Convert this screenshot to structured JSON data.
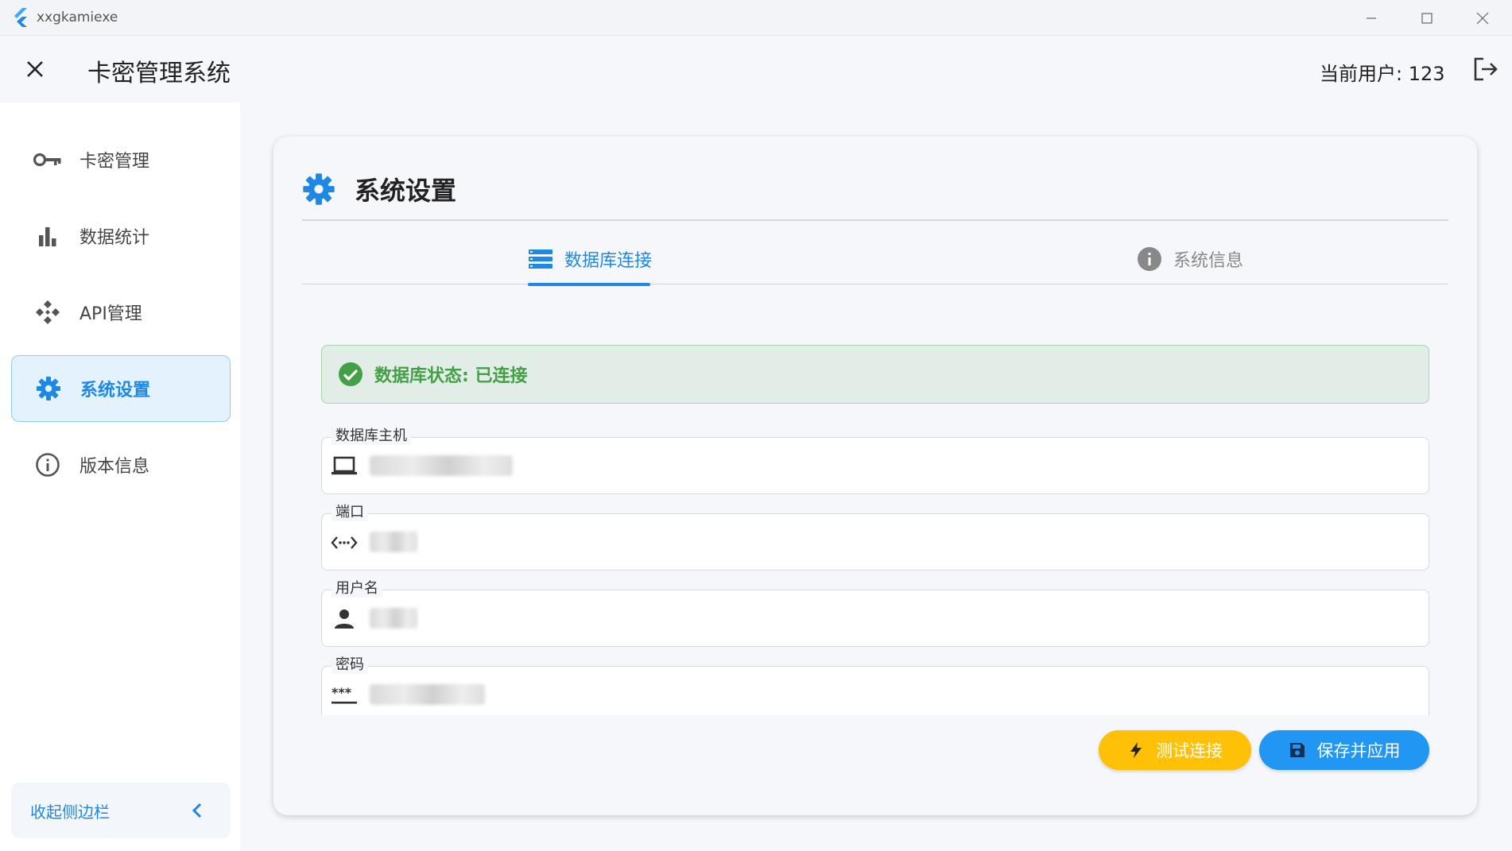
{
  "window": {
    "app_name": "xxgkamiexe",
    "minimize_icon": "minimize-icon",
    "maximize_icon": "maximize-icon",
    "close_icon": "close-icon"
  },
  "appbar": {
    "title": "卡密管理系统",
    "current_user": "当前用户: 123",
    "logout_icon": "logout-icon"
  },
  "sidebar": {
    "items": [
      {
        "label": "卡密管理",
        "icon": "key-icon"
      },
      {
        "label": "数据统计",
        "icon": "bar-chart-icon"
      },
      {
        "label": "API管理",
        "icon": "api-icon"
      },
      {
        "label": "系统设置",
        "icon": "gear-icon",
        "active": true
      },
      {
        "label": "版本信息",
        "icon": "info-icon"
      }
    ],
    "collapse_label": "收起侧边栏"
  },
  "main": {
    "heading": "系统设置",
    "tabs": [
      {
        "label": "数据库连接",
        "icon": "database-icon",
        "active": true
      },
      {
        "label": "系统信息",
        "icon": "info-icon",
        "active": false
      }
    ],
    "status": "数据库状态: 已连接",
    "fields": [
      {
        "label": "数据库主机",
        "icon": "computer-icon"
      },
      {
        "label": "端口",
        "icon": "code-brackets-icon"
      },
      {
        "label": "用户名",
        "icon": "person-icon"
      },
      {
        "label": "密码",
        "icon": "password-icon"
      }
    ],
    "buttons": {
      "test": "测试连接",
      "save": "保存并应用"
    }
  },
  "colors": {
    "accent": "#1e88e5",
    "success": "#43a047",
    "warning_button": "#ffc107",
    "primary_button": "#2196f3"
  }
}
